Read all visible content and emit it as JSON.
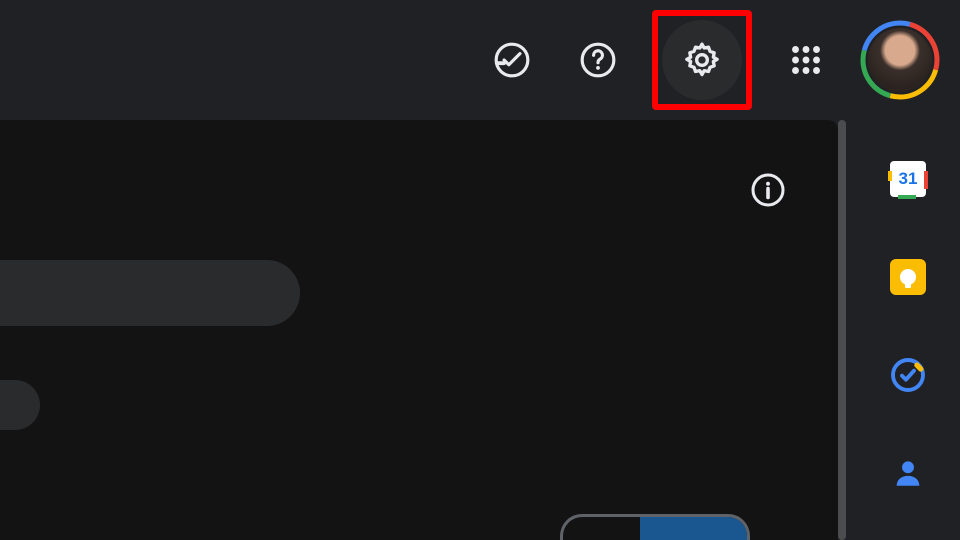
{
  "topbar": {
    "offline_ready_icon": "offline-ready",
    "help_icon": "help",
    "settings_icon": "settings",
    "apps_icon": "apps-grid",
    "avatar_label": "account"
  },
  "highlight": {
    "target": "settings-button",
    "border_color": "#ff0000"
  },
  "main": {
    "info_icon": "information"
  },
  "side_panel": {
    "items": [
      {
        "name": "calendar",
        "label": "31"
      },
      {
        "name": "keep"
      },
      {
        "name": "tasks"
      },
      {
        "name": "contacts"
      }
    ]
  },
  "colors": {
    "bg": "#202124",
    "card": "#131314",
    "pill": "#2a2b2d",
    "icon": "#e8eaed",
    "google_blue": "#4285f4",
    "google_red": "#ea4335",
    "google_yellow": "#fbbc04",
    "google_green": "#34a853"
  }
}
